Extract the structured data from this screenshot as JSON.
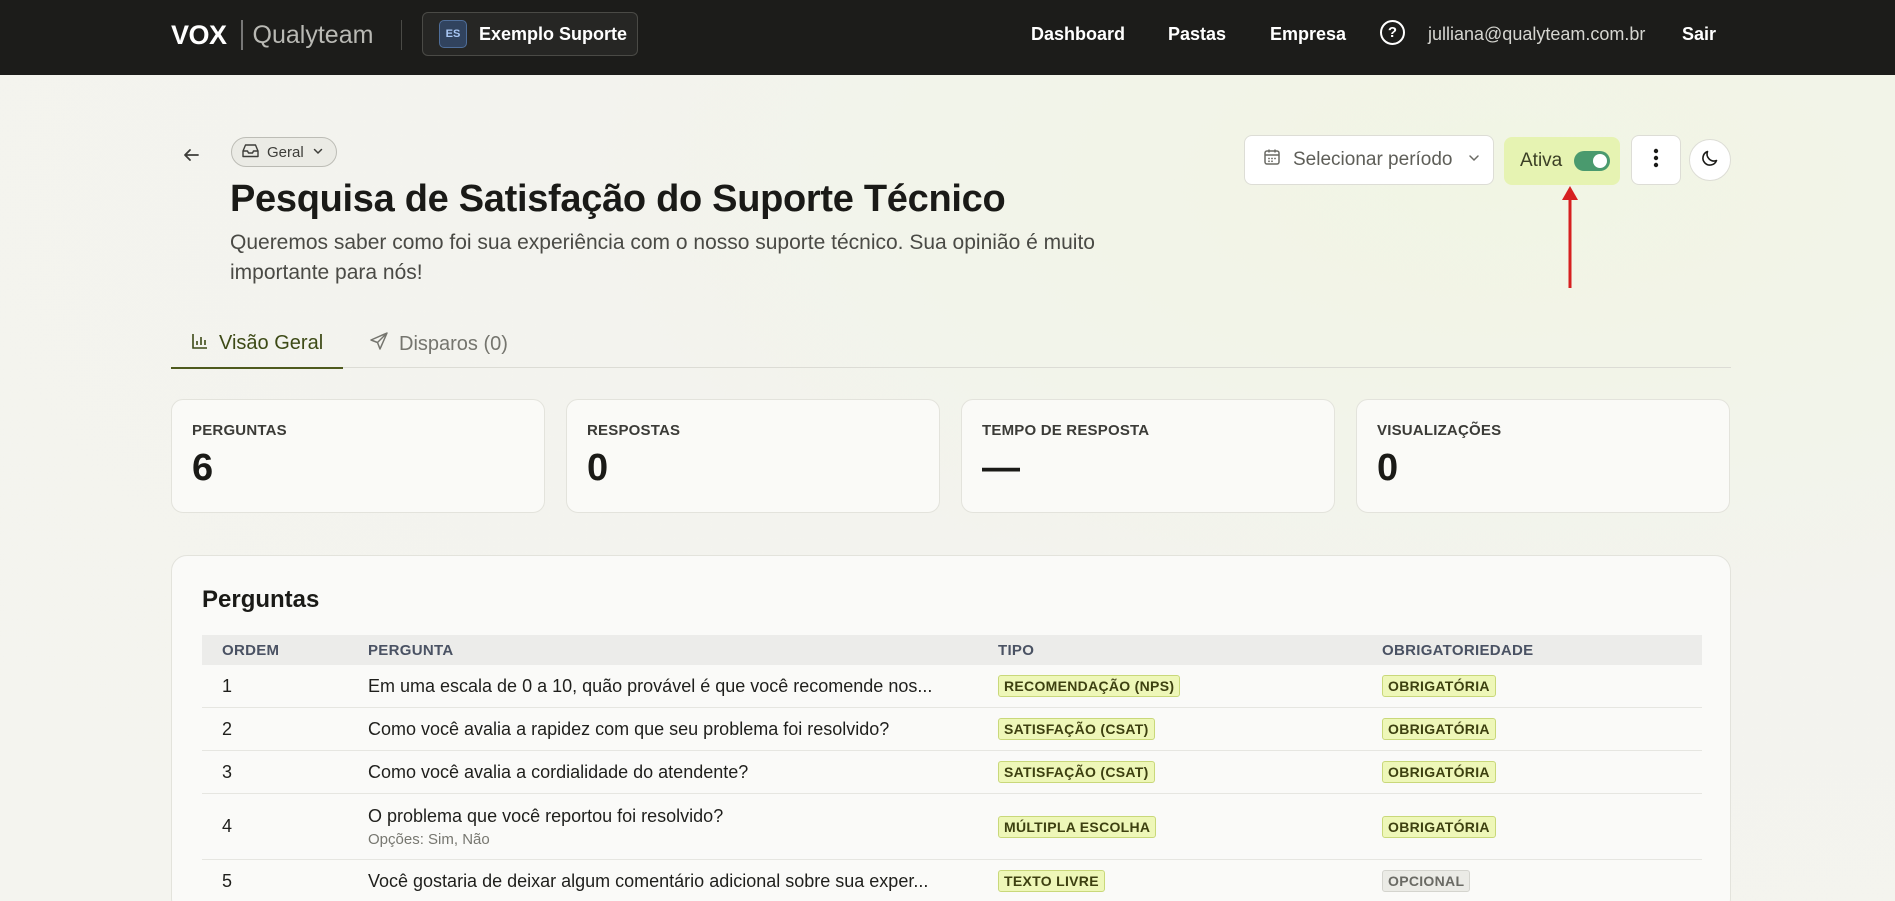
{
  "nav": {
    "brand_primary": "VOX",
    "brand_secondary": "Qualyteam",
    "org_initials": "ES",
    "org_name": "Exemplo Suporte",
    "links": [
      "Dashboard",
      "Pastas",
      "Empresa"
    ],
    "help_glyph": "?",
    "user_email": "julliana@qualyteam.com.br",
    "logout": "Sair"
  },
  "header": {
    "folder_badge": "Geral",
    "title": "Pesquisa de Satisfação do Suporte Técnico",
    "description": "Queremos saber como foi sua experiência com o nosso suporte técnico. Sua opinião é muito importante para nós!",
    "period_placeholder": "Selecionar período",
    "status_label": "Ativa",
    "status_active": true
  },
  "tabs": [
    {
      "label": "Visão Geral",
      "active": true
    },
    {
      "label": "Disparos (0)",
      "active": false
    }
  ],
  "stats": [
    {
      "label": "PERGUNTAS",
      "value": "6"
    },
    {
      "label": "RESPOSTAS",
      "value": "0"
    },
    {
      "label": "TEMPO DE RESPOSTA",
      "value": "—"
    },
    {
      "label": "VISUALIZAÇÕES",
      "value": "0"
    }
  ],
  "questions": {
    "title": "Perguntas",
    "columns": [
      "ORDEM",
      "PERGUNTA",
      "TIPO",
      "OBRIGATORIEDADE"
    ],
    "rows": [
      {
        "order": "1",
        "text": "Em uma escala de 0 a 10, quão provável é que você recomende nos...",
        "sub": "",
        "type": "RECOMENDAÇÃO (NPS)",
        "required": "OBRIGATÓRIA"
      },
      {
        "order": "2",
        "text": "Como você avalia a rapidez com que seu problema foi resolvido?",
        "sub": "",
        "type": "SATISFAÇÃO (CSAT)",
        "required": "OBRIGATÓRIA"
      },
      {
        "order": "3",
        "text": "Como você avalia a cordialidade do atendente?",
        "sub": "",
        "type": "SATISFAÇÃO (CSAT)",
        "required": "OBRIGATÓRIA"
      },
      {
        "order": "4",
        "text": "O problema que você reportou foi resolvido?",
        "sub": "Opções: Sim, Não",
        "type": "MÚLTIPLA ESCOLHA",
        "required": "OBRIGATÓRIA"
      },
      {
        "order": "5",
        "text": "Você gostaria de deixar algum comentário adicional sobre sua exper...",
        "sub": "",
        "type": "TEXTO LIVRE",
        "required": "OPCIONAL"
      }
    ]
  },
  "colors": {
    "topbar": "#1c1c1a",
    "accent_green": "#4a9a6e",
    "active_pill": "#e6f3b2",
    "annotation_arrow": "#d62020"
  }
}
